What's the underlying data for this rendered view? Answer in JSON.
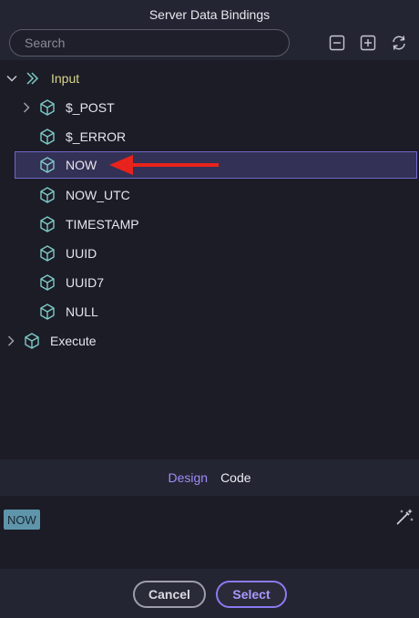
{
  "window": {
    "title": "Server Data Bindings"
  },
  "search": {
    "placeholder": "Search"
  },
  "toolbar": {
    "icons": [
      "collapse-all-icon",
      "expand-all-icon",
      "refresh-icon"
    ]
  },
  "tree": {
    "input": {
      "label": "Input",
      "children": [
        {
          "label": "$_POST",
          "expandable": true
        },
        {
          "label": "$_ERROR",
          "expandable": false
        },
        {
          "label": "NOW",
          "expandable": false,
          "selected": true
        },
        {
          "label": "NOW_UTC",
          "expandable": false
        },
        {
          "label": "TIMESTAMP",
          "expandable": false
        },
        {
          "label": "UUID",
          "expandable": false
        },
        {
          "label": "UUID7",
          "expandable": false
        },
        {
          "label": "NULL",
          "expandable": false
        }
      ]
    },
    "execute": {
      "label": "Execute"
    }
  },
  "tabs": {
    "design": "Design",
    "code": "Code",
    "active": "Design"
  },
  "editor": {
    "token": "NOW"
  },
  "footer": {
    "cancel": "Cancel",
    "select": "Select"
  },
  "colors": {
    "accent": "#9b8cf5",
    "cube": "#7ec9c7",
    "selected_bg": "#333155",
    "arrow": "#e8231c",
    "token_bg": "#5e95ab"
  }
}
